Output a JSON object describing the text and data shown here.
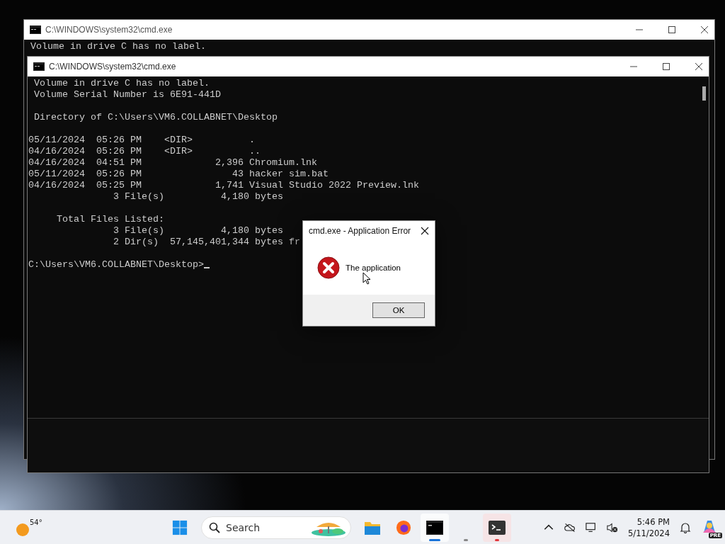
{
  "windows": [
    {
      "title": "C:\\WINDOWS\\system32\\cmd.exe",
      "focused": false,
      "blocks": [
        [
          " Volume in drive C has no label."
        ]
      ]
    },
    {
      "title": "C:\\WINDOWS\\system32\\cmd.exe",
      "focused": true,
      "blocks": [
        [
          " Volume in drive C has no label.",
          " Volume Serial Number is 6E91-441D"
        ],
        [
          " Directory of C:\\Users\\VM6.COLLABNET\\Desktop"
        ],
        [
          "05/11/2024  05:26 PM    <DIR>          .",
          "04/16/2024  05:26 PM    <DIR>          ..",
          "04/16/2024  04:51 PM             2,396 Chromium.lnk",
          "05/11/2024  05:26 PM                43 hacker sim.bat",
          "04/16/2024  05:25 PM             1,741 Visual Studio 2022 Preview.lnk",
          "               3 File(s)          4,180 bytes"
        ],
        [
          "     Total Files Listed:",
          "               3 File(s)          4,180 bytes",
          "               2 Dir(s)  57,145,401,344 bytes fr"
        ],
        [
          "C:\\Users\\VM6.COLLABNET\\Desktop>"
        ]
      ],
      "cursor": true
    }
  ],
  "dialog": {
    "title": "cmd.exe - Application Error",
    "message": "The application",
    "button": "OK"
  },
  "taskbar": {
    "weather": "54°",
    "search": {
      "placeholder": "Search"
    },
    "apps": [
      {
        "kind": "start",
        "open": false,
        "selected": false,
        "alert": false
      },
      {
        "kind": "folder",
        "open": false,
        "selected": false,
        "alert": false
      },
      {
        "kind": "browser",
        "open": false,
        "selected": false,
        "alert": false
      },
      {
        "kind": "console",
        "open": true,
        "selected": true,
        "alert": false
      },
      {
        "kind": "blank",
        "open": true,
        "selected": false,
        "alert": false
      },
      {
        "kind": "terminal",
        "open": true,
        "selected": false,
        "alert": true
      }
    ],
    "time": "5:46 PM",
    "date": "5/11/2024",
    "copilot_badge": "PRE"
  }
}
